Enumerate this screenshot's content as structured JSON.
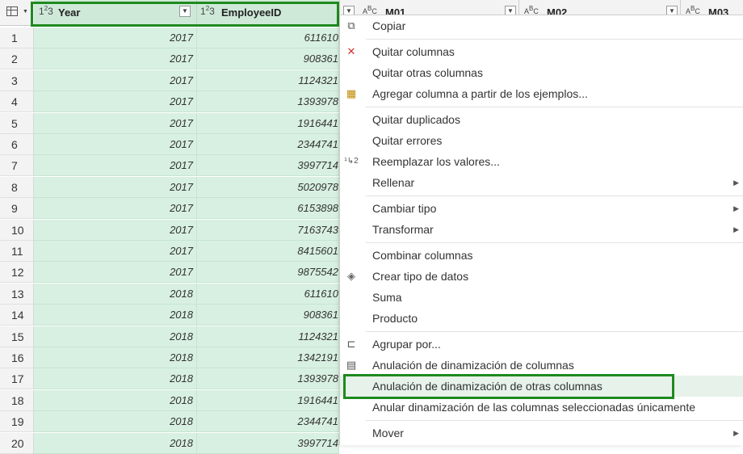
{
  "header": {
    "year_label": "Year",
    "employee_label": "EmployeeID",
    "m01_label": "M01",
    "m02_label": "M02",
    "m03_label": "M03",
    "type_num": "123",
    "type_text": "ABC"
  },
  "rows": [
    {
      "n": "1",
      "year": "2017",
      "emp": "611610"
    },
    {
      "n": "2",
      "year": "2017",
      "emp": "908361"
    },
    {
      "n": "3",
      "year": "2017",
      "emp": "1124321"
    },
    {
      "n": "4",
      "year": "2017",
      "emp": "1393978"
    },
    {
      "n": "5",
      "year": "2017",
      "emp": "1916441"
    },
    {
      "n": "6",
      "year": "2017",
      "emp": "2344741"
    },
    {
      "n": "7",
      "year": "2017",
      "emp": "3997714"
    },
    {
      "n": "8",
      "year": "2017",
      "emp": "5020978"
    },
    {
      "n": "9",
      "year": "2017",
      "emp": "6153898"
    },
    {
      "n": "10",
      "year": "2017",
      "emp": "7163743"
    },
    {
      "n": "11",
      "year": "2017",
      "emp": "8415601"
    },
    {
      "n": "12",
      "year": "2017",
      "emp": "9875542"
    },
    {
      "n": "13",
      "year": "2018",
      "emp": "611610"
    },
    {
      "n": "14",
      "year": "2018",
      "emp": "908361"
    },
    {
      "n": "15",
      "year": "2018",
      "emp": "1124321"
    },
    {
      "n": "16",
      "year": "2018",
      "emp": "1342191"
    },
    {
      "n": "17",
      "year": "2018",
      "emp": "1393978"
    },
    {
      "n": "18",
      "year": "2018",
      "emp": "1916441"
    },
    {
      "n": "19",
      "year": "2018",
      "emp": "2344741"
    },
    {
      "n": "20",
      "year": "2018",
      "emp": "3997714"
    }
  ],
  "menu": {
    "copiar": "Copiar",
    "quitar_columnas": "Quitar columnas",
    "quitar_otras": "Quitar otras columnas",
    "agregar_ejemplos": "Agregar columna a partir de los ejemplos...",
    "quitar_duplicados": "Quitar duplicados",
    "quitar_errores": "Quitar errores",
    "reemplazar": "Reemplazar los valores...",
    "rellenar": "Rellenar",
    "cambiar_tipo": "Cambiar tipo",
    "transformar": "Transformar",
    "combinar": "Combinar columnas",
    "crear_tipo": "Crear tipo de datos",
    "suma": "Suma",
    "producto": "Producto",
    "agrupar": "Agrupar por...",
    "anulacion_columnas": "Anulación de dinamización de columnas",
    "anulacion_otras": "Anulación de dinamización de otras columnas",
    "anular_seleccionadas": "Anular dinamización de las columnas seleccionadas únicamente",
    "mover": "Mover"
  }
}
